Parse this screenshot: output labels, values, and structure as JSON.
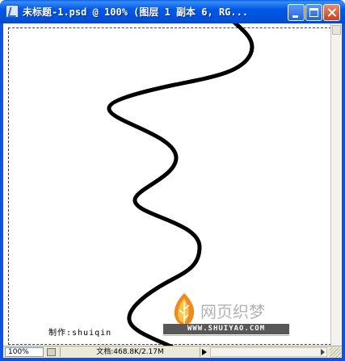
{
  "window": {
    "title": "未标题-1.psd @ 100% (图层 1 副本 6, RG..."
  },
  "title_buttons": {
    "minimize_icon": "minimize-icon",
    "maximize_icon": "maximize-icon",
    "close_icon": "close-icon"
  },
  "canvas": {
    "credit_text": "制作:shuiqin",
    "logo": {
      "name_cn": "网页织梦",
      "url": "WWW.SHUIYAO.COM"
    }
  },
  "statusbar": {
    "zoom": "100%",
    "doc_info": "文档:468.8K/2.17M"
  },
  "colors": {
    "titlebar": "#0058e6",
    "close_button": "#c4401c",
    "logo_flame_orange": "#f08a1c",
    "logo_flame_yellow": "#f7c64a",
    "statusbar": "#ece9d8"
  }
}
